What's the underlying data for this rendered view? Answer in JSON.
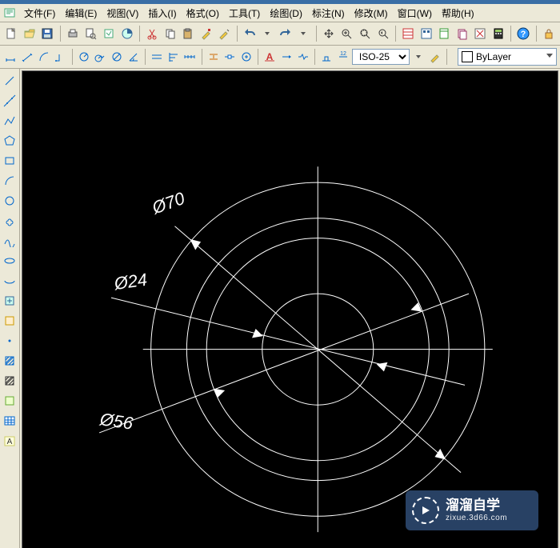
{
  "menu": {
    "file": "文件(F)",
    "edit": "编辑(E)",
    "view": "视图(V)",
    "insert": "插入(I)",
    "format": "格式(O)",
    "tools": "工具(T)",
    "draw": "绘图(D)",
    "dim": "标注(N)",
    "modify": "修改(M)",
    "window": "窗口(W)",
    "help": "帮助(H)"
  },
  "toolbar1": {
    "icons": [
      "new",
      "open",
      "save",
      "|",
      "print",
      "preview",
      "publish",
      "plot",
      "|",
      "cut",
      "copy",
      "paste",
      "match",
      "format-paint",
      "|",
      "undo",
      "undo-dd",
      "redo",
      "redo-dd",
      "|",
      "pan",
      "zoom-in",
      "zoom-window",
      "zoom-ext",
      "|",
      "layers",
      "properties",
      "design",
      "sheet",
      "tool-pal",
      "calc",
      "|",
      "help",
      "|",
      "lock"
    ]
  },
  "toolbar2": {
    "icons_left": [
      "dim-linear",
      "dim-aligned",
      "dim-arc",
      "dim-ordinate",
      "|",
      "dim-radius",
      "dim-jog",
      "dim-diameter",
      "dim-angle",
      "|",
      "dim-quick",
      "dim-baseline",
      "dim-continue",
      "|",
      "dim-space",
      "dim-break",
      "dim-tol",
      "|",
      "dim-center",
      "dim-inspect",
      "dim-jogline",
      "|",
      "dim-edit",
      "dim-tedit"
    ],
    "style_value": "ISO-25",
    "icons_right": [
      "dim-update"
    ],
    "layer_label": "ByLayer"
  },
  "left_tools": [
    "line",
    "construction-line",
    "polyline",
    "polygon",
    "rectangle",
    "arc",
    "circle",
    "revcloud",
    "spline",
    "ellipse",
    "ellipse-arc",
    "insert-block",
    "make-block",
    "point",
    "hatch",
    "gradient",
    "region",
    "table",
    "mtext"
  ],
  "drawing": {
    "dims": {
      "d70": "Ø70",
      "d24": "Ø24",
      "d56": "Ø56"
    }
  },
  "watermark": {
    "line1": "溜溜自学",
    "line2": "zixue.3d66.com"
  }
}
